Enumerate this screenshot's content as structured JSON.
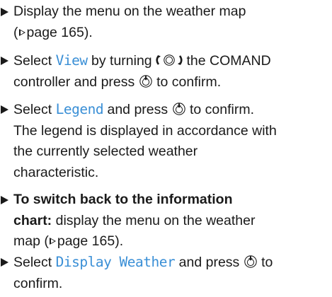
{
  "steps": [
    {
      "line1": "Display the menu on the weather map",
      "line2_pre": "(",
      "page_ref": "page 165",
      "line2_post": ")."
    },
    {
      "pre": "Select ",
      "key": "View",
      "mid": " by turning ",
      "mid2": " the COMAND",
      "line2": "controller and press ",
      "end": " to confirm."
    },
    {
      "pre": "Select ",
      "key": "Legend",
      "mid": " and press ",
      "end": " to confirm.",
      "desc1": "The legend is displayed in accordance with",
      "desc2": "the currently selected weather",
      "desc3": "characteristic."
    },
    {
      "bold1": "To switch back to the information",
      "bold2": "chart:",
      "rest2": " display the menu on the weather",
      "line3_pre": "map (",
      "page_ref": "page 165",
      "line3_post": ")."
    },
    {
      "pre": "Select ",
      "key": "Display Weather",
      "mid": " and press ",
      "end": " to",
      "line2": "confirm."
    }
  ],
  "icons": {
    "turn": "controller-turn-icon",
    "press": "controller-press-icon",
    "page_ref": "page-reference-arrow-icon",
    "bullet": "step-bullet-icon"
  },
  "colors": {
    "text": "#1a1a1a",
    "key_highlight": "#3a8fd6"
  }
}
